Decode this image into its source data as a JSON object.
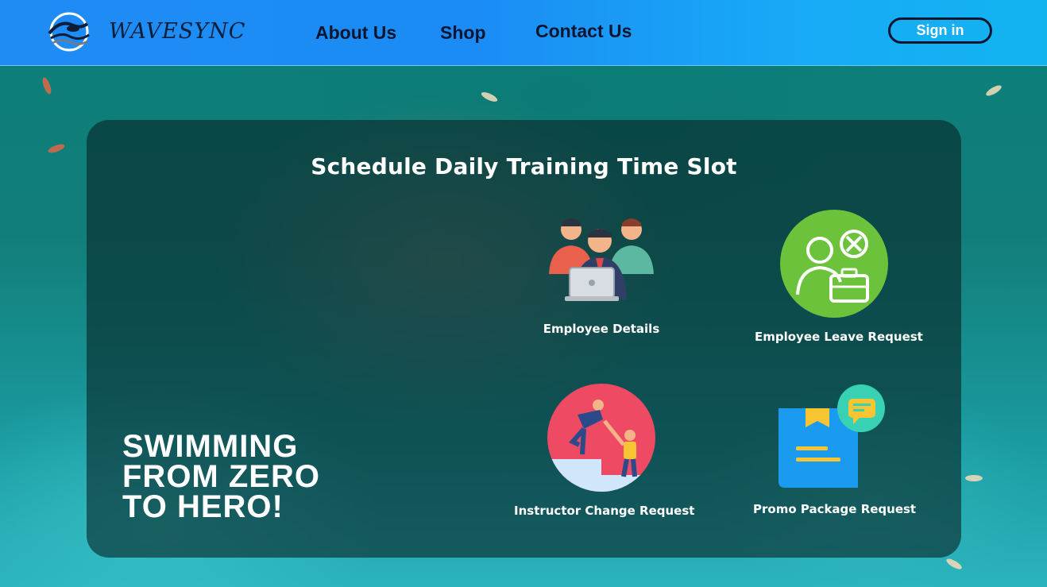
{
  "header": {
    "brand": "WAVESYNC",
    "nav": [
      "About Us",
      "Shop",
      "Contact Us"
    ],
    "signin_label": "Sign in"
  },
  "panel": {
    "title": "Schedule Daily Training Time Slot",
    "slogan": [
      "SWIMMING",
      "FROM ZERO",
      "TO HERO!"
    ],
    "cards": [
      {
        "label": "Employee Details",
        "icon": "employee-group-icon"
      },
      {
        "label": "Employee Leave Request",
        "icon": "employee-leave-icon"
      },
      {
        "label": "Instructor Change Request",
        "icon": "helping-hand-icon"
      },
      {
        "label": "Promo Package Request",
        "icon": "promo-document-icon"
      }
    ]
  },
  "colors": {
    "header_start": "#1f8cf4",
    "header_end": "#12b4f0",
    "nav_text": "#0c1530",
    "panel_bg": "rgba(8,38,40,0.62)",
    "leave_green": "#6cc33b",
    "instructor_pink": "#ef4a63",
    "promo_blue": "#1a9bf0"
  }
}
